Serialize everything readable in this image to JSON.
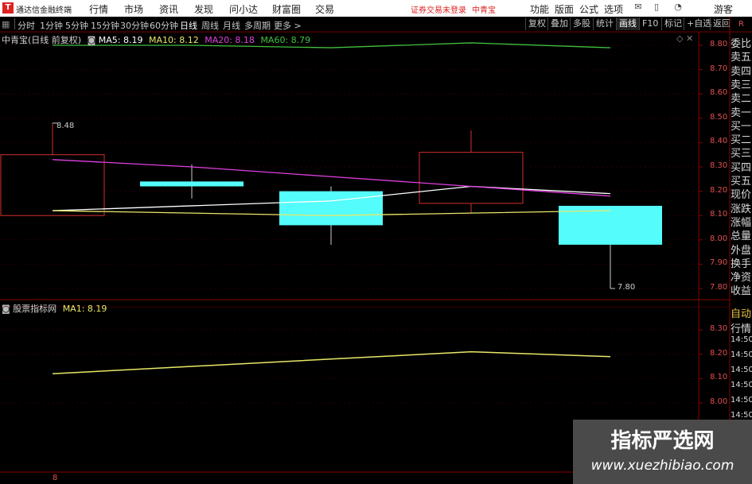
{
  "app": {
    "logo_glyph": "T",
    "title": "通达信金融终端",
    "menu": [
      "行情",
      "市场",
      "资讯",
      "发现",
      "问小达",
      "财富圈",
      "交易"
    ],
    "status_red": "证券交易未登录",
    "stock_name_top": "中青宝",
    "right_menu": [
      "功能",
      "版面",
      "公式",
      "选项"
    ],
    "user": "游客"
  },
  "toolbar": {
    "periods": [
      "分时",
      "1分钟",
      "5分钟",
      "15分钟",
      "30分钟",
      "60分钟",
      "日线",
      "周线",
      "月线",
      "多周期",
      "更多 >"
    ],
    "active_period": "日线",
    "right_buttons": [
      "复权",
      "叠加",
      "多股",
      "统计",
      "画线",
      "F10",
      "标记",
      "+自选",
      "返回"
    ]
  },
  "main_chart": {
    "stock_label": "中青宝(日线 前复权)",
    "ma": [
      {
        "label": "MA5: 8.19",
        "color": "#ffffff"
      },
      {
        "label": "MA10: 8.12",
        "color": "#e8e868"
      },
      {
        "label": "MA20: 8.18",
        "color": "#e040e0"
      },
      {
        "label": "MA60: 8.79",
        "color": "#40c040"
      }
    ],
    "price_ticks": [
      "8.80",
      "8.70",
      "8.60",
      "8.50",
      "8.40",
      "8.30",
      "8.20",
      "8.10",
      "8.00",
      "7.90",
      "7.80"
    ],
    "high_label": "8.48",
    "low_label": "7.80"
  },
  "sub_chart": {
    "label": "股票指标网",
    "ma1": "MA1: 8.19",
    "ticks": [
      "8.30",
      "8.20",
      "8.10",
      "8.00"
    ]
  },
  "right_panel": {
    "top_letter": "R",
    "items": [
      "委比",
      "卖五",
      "卖四",
      "卖三",
      "卖二",
      "卖一",
      "买一",
      "买二",
      "买三",
      "买四",
      "买五",
      "现价",
      "涨跌",
      "涨幅",
      "总量",
      "外盘",
      "换手",
      "净资",
      "收益"
    ],
    "lower_items": [
      "自动",
      "行情",
      "14:50",
      "14:50",
      "14:50",
      "14:50",
      "14:50",
      "14:50",
      "14:50"
    ]
  },
  "bottom": {
    "label": "8"
  },
  "watermark": {
    "title": "指标严选网",
    "url": "www.xuezhibiao.com"
  },
  "chart_data": {
    "type": "candlestick",
    "candles": [
      {
        "open": 8.1,
        "close": 8.35,
        "high": 8.48,
        "low": 8.1,
        "color": "red"
      },
      {
        "open": 8.24,
        "close": 8.22,
        "high": 8.31,
        "low": 8.17,
        "color": "cyan"
      },
      {
        "open": 8.2,
        "close": 8.06,
        "high": 8.22,
        "low": 7.98,
        "color": "cyan"
      },
      {
        "open": 8.15,
        "close": 8.36,
        "high": 8.45,
        "low": 8.11,
        "color": "red"
      },
      {
        "open": 8.14,
        "close": 7.98,
        "high": 8.14,
        "low": 7.8,
        "color": "cyan"
      }
    ],
    "ma_series": [
      {
        "name": "MA5",
        "values": [
          8.12,
          8.14,
          8.16,
          8.22,
          8.19
        ]
      },
      {
        "name": "MA10",
        "values": [
          8.12,
          8.11,
          8.1,
          8.11,
          8.12
        ]
      },
      {
        "name": "MA20",
        "values": [
          8.33,
          8.3,
          8.26,
          8.22,
          8.18
        ]
      },
      {
        "name": "MA60",
        "values": [
          8.8,
          8.8,
          8.79,
          8.81,
          8.79
        ]
      }
    ],
    "ma1_values": [
      8.12,
      8.15,
      8.18,
      8.21,
      8.19
    ],
    "ylim": [
      7.75,
      8.85
    ],
    "sub_ylim": [
      7.95,
      8.35
    ]
  }
}
